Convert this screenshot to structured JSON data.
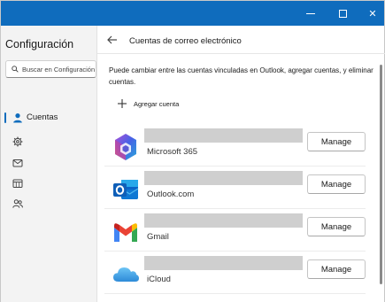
{
  "window": {
    "controls": {
      "minimize_icon": "minimize-icon",
      "maximize_icon": "maximize-icon",
      "close_label": "✕"
    }
  },
  "sidebar": {
    "title": "Configuración",
    "search_placeholder": "Buscar en Configuración",
    "items": [
      {
        "label": "Cuentas",
        "icon": "person-icon",
        "active": true
      },
      {
        "label": "",
        "icon": "gear-icon"
      },
      {
        "label": "",
        "icon": "mail-icon"
      },
      {
        "label": "",
        "icon": "calendar-icon"
      },
      {
        "label": "",
        "icon": "people-icon"
      }
    ]
  },
  "main": {
    "title": "Cuentas de correo electrónico",
    "description": "Puede cambiar entre las cuentas vinculadas en Outlook, agregar cuentas, y eliminar cuentas.",
    "add_account_label": "Agregar cuenta",
    "accounts": [
      {
        "name": "Microsoft 365",
        "manage_label": "Manage",
        "logo": "microsoft-365-logo"
      },
      {
        "name": "Outlook.com",
        "manage_label": "Manage",
        "logo": "outlook-logo"
      },
      {
        "name": "Gmail",
        "manage_label": "Manage",
        "logo": "gmail-logo"
      },
      {
        "name": "iCloud",
        "manage_label": "Manage",
        "logo": "icloud-logo"
      }
    ]
  },
  "colors": {
    "accent": "#0f6cbd",
    "titlebar": "#0f6cbd",
    "sidebar_bg": "#f3f3f3"
  }
}
